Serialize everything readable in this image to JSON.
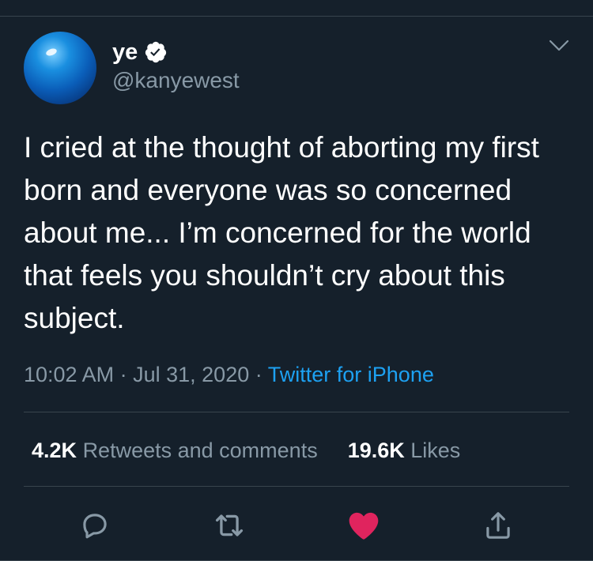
{
  "tweet": {
    "display_name": "ye",
    "handle": "@kanyewest",
    "verified": true,
    "text": "I cried at the thought of aborting my first born and everyone was so concerned about me... I’m concerned for the world that feels you shouldn’t cry about this subject.",
    "time": "10:02 AM",
    "separator": "·",
    "date": "Jul 31, 2020",
    "source": "Twitter for iPhone"
  },
  "stats": {
    "retweets_count": "4.2K",
    "retweets_label": "Retweets and comments",
    "likes_count": "19.6K",
    "likes_label": "Likes"
  },
  "icons": {
    "avatar": "avatar-image",
    "verified": "verified-badge-icon",
    "more": "chevron-down-icon",
    "reply": "reply-icon",
    "retweet": "retweet-icon",
    "like": "heart-icon",
    "share": "share-icon"
  },
  "colors": {
    "background": "#15202b",
    "text": "#ffffff",
    "secondary_text": "#8899a6",
    "link": "#1da1f2",
    "like_active": "#e0245e",
    "divider": "#38444d"
  },
  "state": {
    "liked": true
  }
}
